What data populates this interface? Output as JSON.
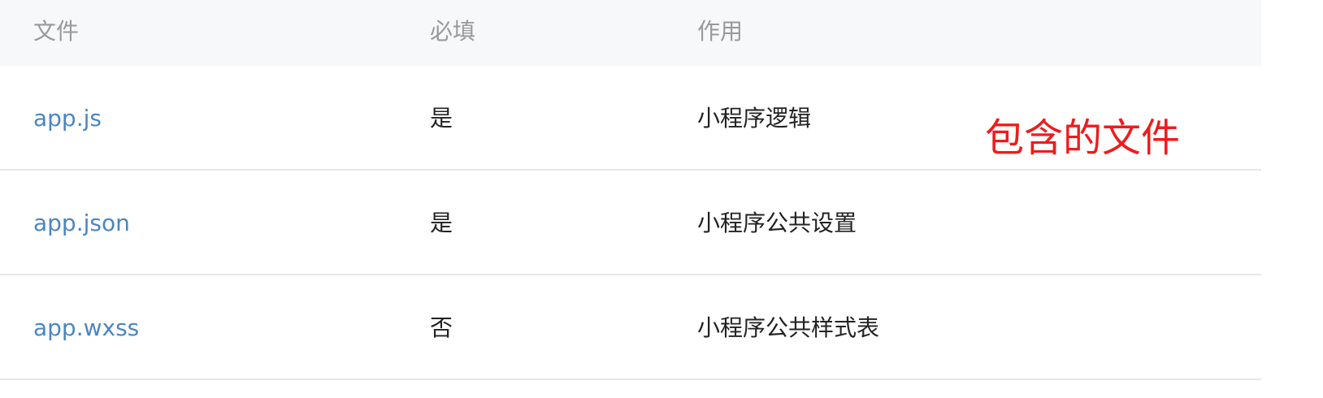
{
  "table": {
    "headers": [
      "文件",
      "必填",
      "作用"
    ],
    "rows": [
      {
        "file": "app.js",
        "required": "是",
        "purpose": "小程序逻辑"
      },
      {
        "file": "app.json",
        "required": "是",
        "purpose": "小程序公共设置"
      },
      {
        "file": "app.wxss",
        "required": "否",
        "purpose": "小程序公共样式表"
      }
    ]
  },
  "annotation": {
    "text": "包含的文件",
    "color": "#ee1c1c"
  },
  "colors": {
    "link": "#4a86c1",
    "header_bg": "#f7f8f9",
    "header_text": "#999999",
    "divider": "#e6e6e6"
  }
}
